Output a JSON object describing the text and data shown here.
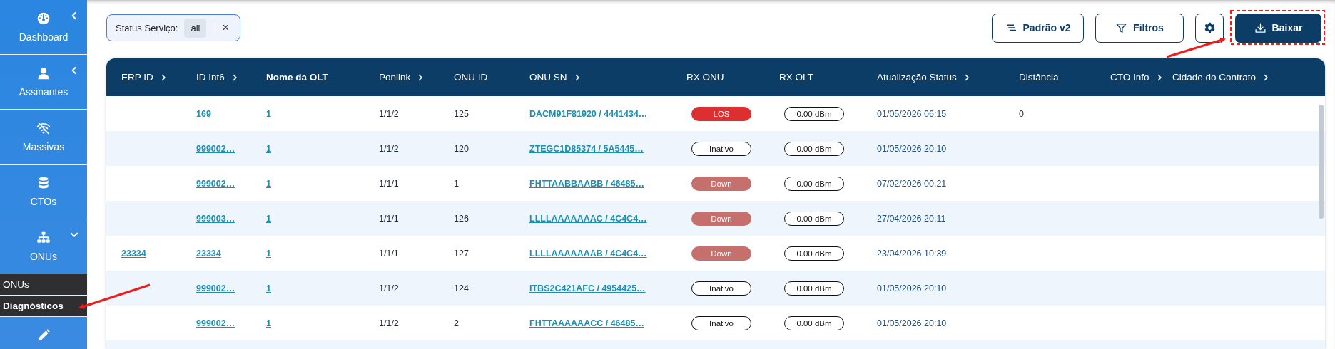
{
  "sidebar": {
    "items": [
      {
        "label": "Dashboard",
        "expanded": false
      },
      {
        "label": "Assinantes",
        "expanded": false
      },
      {
        "label": "Massivas"
      },
      {
        "label": "CTOs"
      },
      {
        "label": "ONUs",
        "expanded": true,
        "children": [
          {
            "label": "ONUs",
            "selected": false
          },
          {
            "label": "Diagnósticos",
            "selected": true
          }
        ]
      },
      {
        "kind": "icon-only"
      }
    ]
  },
  "filter_chip": {
    "label": "Status Serviço:",
    "value": "all",
    "remove": "×"
  },
  "toolbar": {
    "buttons": [
      {
        "kind": "outline",
        "label": "Padrão v2"
      },
      {
        "kind": "outline",
        "label": "Filtros"
      },
      {
        "kind": "icon"
      },
      {
        "kind": "primary",
        "label": "Baixar"
      }
    ]
  },
  "table": {
    "columns": [
      {
        "label": "ERP ID",
        "sortable": true
      },
      {
        "label": "ID Int6",
        "sortable": true
      },
      {
        "label": "Nome da OLT",
        "sortable": false,
        "bold": true
      },
      {
        "label": "Ponlink",
        "sortable": true
      },
      {
        "label": "ONU ID",
        "sortable": false
      },
      {
        "label": "ONU SN",
        "sortable": true
      },
      {
        "label": "RX ONU",
        "sortable": false
      },
      {
        "label": "RX OLT",
        "sortable": false
      },
      {
        "label": "Atualização Status",
        "sortable": true
      },
      {
        "label": "Distância",
        "sortable": false
      },
      {
        "label": "CTO Info",
        "sortable": true
      },
      {
        "label": "Cidade do Contrato",
        "sortable": true
      }
    ],
    "rows": [
      {
        "id_int6": "169",
        "olt": "1",
        "ponlink": "1/1/2",
        "onu_id": "125",
        "onu_sn": "DACM91F81920 / 4441434…",
        "rx_onu": {
          "label": "LOS",
          "kind": "los"
        },
        "rx_olt": "0.00 dBm",
        "updated": "01/05/2026 06:15",
        "distance": "0"
      },
      {
        "id_int6": "999002…",
        "olt": "1",
        "ponlink": "1/1/2",
        "onu_id": "120",
        "onu_sn": "ZTEGC1D85374 / 5A5445…",
        "rx_onu": {
          "label": "Inativo",
          "kind": "inactive"
        },
        "rx_olt": "0.00 dBm",
        "updated": "01/05/2026 20:10"
      },
      {
        "id_int6": "999002…",
        "olt": "1",
        "ponlink": "1/1/1",
        "onu_id": "1",
        "onu_sn": "FHTTAABBAABB / 46485…",
        "rx_onu": {
          "label": "Down",
          "kind": "down"
        },
        "rx_olt": "0.00 dBm",
        "updated": "07/02/2026 00:21"
      },
      {
        "id_int6": "999003…",
        "olt": "1",
        "ponlink": "1/1/1",
        "onu_id": "126",
        "onu_sn": "LLLLAAAAAAAC / 4C4C4…",
        "rx_onu": {
          "label": "Down",
          "kind": "down"
        },
        "rx_olt": "0.00 dBm",
        "updated": "27/04/2026 20:11"
      },
      {
        "erp_id": "23334",
        "id_int6": "23334",
        "olt": "1",
        "ponlink": "1/1/1",
        "onu_id": "127",
        "onu_sn": "LLLLAAAAAAAB / 4C4C4…",
        "rx_onu": {
          "label": "Down",
          "kind": "down"
        },
        "rx_olt": "0.00 dBm",
        "updated": "23/04/2026 10:39"
      },
      {
        "id_int6": "999002…",
        "olt": "1",
        "ponlink": "1/1/2",
        "onu_id": "124",
        "onu_sn": "ITBS2C421AFC / 4954425…",
        "rx_onu": {
          "label": "Inativo",
          "kind": "inactive"
        },
        "rx_olt": "0.00 dBm",
        "updated": "01/05/2026 20:10"
      },
      {
        "id_int6": "999002…",
        "olt": "1",
        "ponlink": "1/1/2",
        "onu_id": "2",
        "onu_sn": "FHTTAAAAAACC / 46485…",
        "rx_onu": {
          "label": "Inativo",
          "kind": "inactive"
        },
        "rx_olt": "0.00 dBm",
        "updated": "01/05/2026 20:10"
      }
    ]
  }
}
